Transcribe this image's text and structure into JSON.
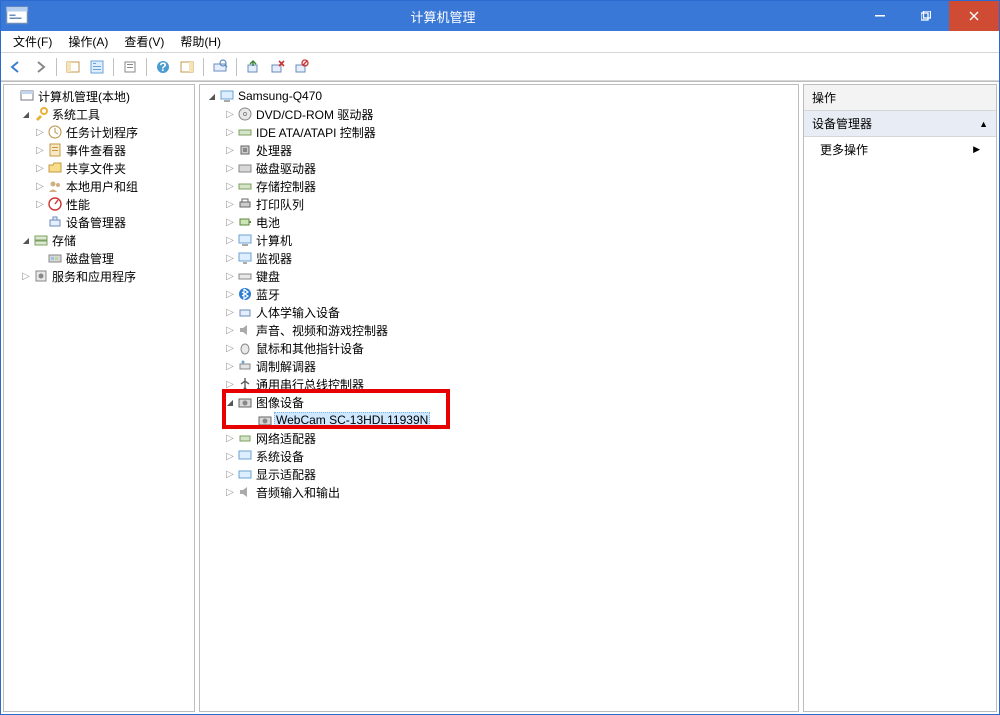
{
  "window": {
    "title": "计算机管理",
    "min": "—",
    "restore": "❐",
    "close": "✕"
  },
  "menu": {
    "file": "文件(F)",
    "action": "操作(A)",
    "view": "查看(V)",
    "help": "帮助(H)"
  },
  "left_tree": {
    "root": "计算机管理(本地)",
    "system_tools": "系统工具",
    "task_scheduler": "任务计划程序",
    "event_viewer": "事件查看器",
    "shared_folders": "共享文件夹",
    "local_users": "本地用户和组",
    "performance": "性能",
    "device_manager": "设备管理器",
    "storage": "存储",
    "disk_mgmt": "磁盘管理",
    "services_apps": "服务和应用程序"
  },
  "mid_tree": {
    "root": "Samsung-Q470",
    "dvd": "DVD/CD-ROM 驱动器",
    "ide": "IDE ATA/ATAPI 控制器",
    "cpu": "处理器",
    "disk_drives": "磁盘驱动器",
    "storage_ctrl": "存储控制器",
    "print_queue": "打印队列",
    "battery": "电池",
    "computer": "计算机",
    "monitor": "监视器",
    "keyboard": "键盘",
    "bluetooth": "蓝牙",
    "hid": "人体学输入设备",
    "sound": "声音、视频和游戏控制器",
    "mouse": "鼠标和其他指针设备",
    "modem": "调制解调器",
    "usb": "通用串行总线控制器",
    "imaging": "图像设备",
    "webcam": "WebCam SC-13HDL11939N",
    "network": "网络适配器",
    "system_dev": "系统设备",
    "display": "显示适配器",
    "audio_io": "音频输入和输出"
  },
  "right": {
    "header": "操作",
    "section": "设备管理器",
    "more": "更多操作"
  }
}
